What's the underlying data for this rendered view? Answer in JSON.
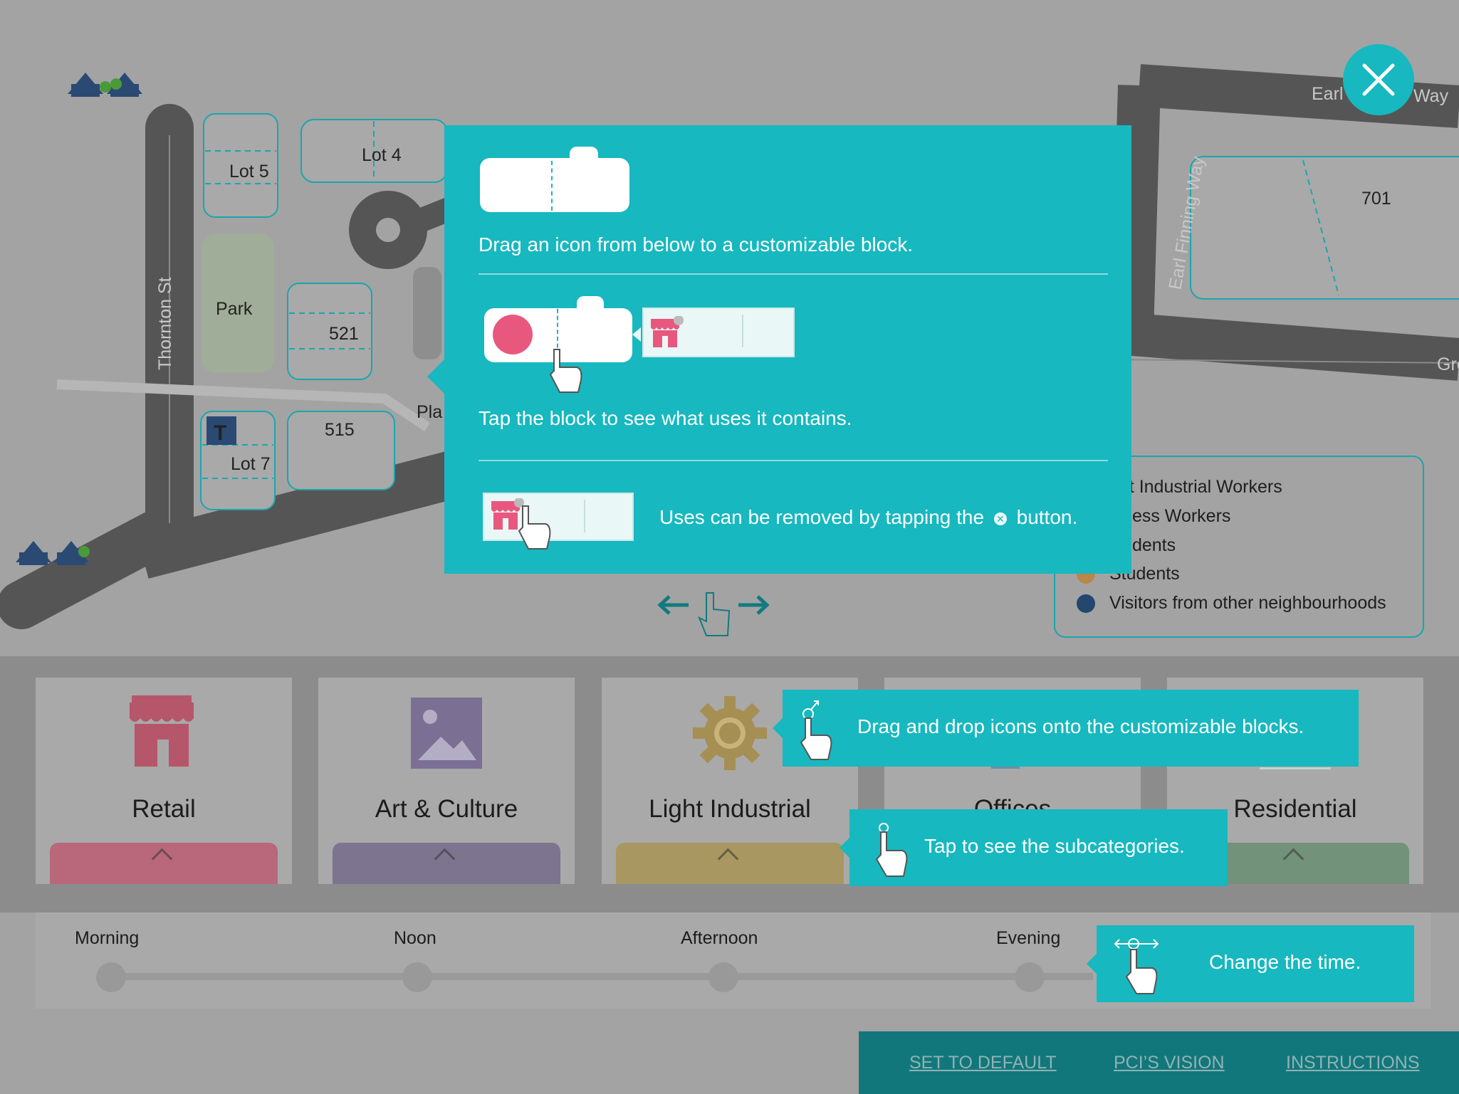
{
  "map": {
    "street_thornton": "Thornton St",
    "street_earl_finning": "Earl Finning Way",
    "street_earl_left": "Earl",
    "street_earl_right": "Way",
    "street_gre": "Gre",
    "lot5": "Lot 5",
    "lot4": "Lot 4",
    "lot7": "Lot 7",
    "lot521": "521",
    "lot515": "515",
    "lot701": "701",
    "park": "Park",
    "pla": "Pla",
    "transit_letter": "T"
  },
  "legend": {
    "items": [
      {
        "label": "ght Industrial Workers",
        "color": ""
      },
      {
        "label": "siness Workers",
        "color": ""
      },
      {
        "label": "esidents",
        "color": ""
      },
      {
        "label": "Students",
        "color": "#b8874a"
      },
      {
        "label": "Visitors from other neighbourhoods",
        "color": "#23476e"
      }
    ]
  },
  "categories": [
    {
      "label": "Retail",
      "icon": "storefront-icon",
      "color": "#c4677a"
    },
    {
      "label": "Art & Culture",
      "icon": "image-icon",
      "color": "#7e7595"
    },
    {
      "label": "Light Industrial",
      "icon": "gear-icon",
      "color": "#a89760"
    },
    {
      "label": "Offices",
      "icon": "office-icon",
      "color": "#6f8fa3"
    },
    {
      "label": "Residential",
      "icon": "house-icon",
      "color": "#72927a"
    }
  ],
  "timeline": {
    "labels": [
      "Morning",
      "Noon",
      "Afternoon",
      "Evening"
    ]
  },
  "footer": {
    "set_default": "SET TO DEFAULT",
    "vision": "PCI’S VISION",
    "instructions": "INSTRUCTIONS"
  },
  "modal": {
    "step1": "Drag an icon from below to a customizable block.",
    "step2": "Tap the block to see what uses it contains.",
    "step3_before": "Uses can be removed by tapping the",
    "step3_after": "button."
  },
  "callouts": {
    "drag": "Drag and drop icons onto the customizable blocks.",
    "tap": "Tap to see the subcategories.",
    "time": "Change the time."
  },
  "colors": {
    "accent": "#17b8bf",
    "retail_pink": "#e8587e"
  }
}
